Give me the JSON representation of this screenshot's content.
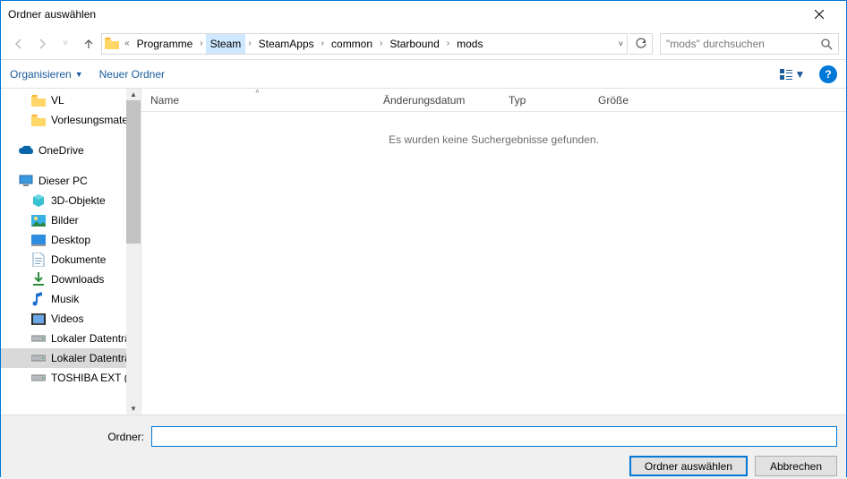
{
  "window": {
    "title": "Ordner auswählen"
  },
  "breadcrumb": {
    "overflow": "«",
    "segments": [
      {
        "label": "Programme",
        "selected": false
      },
      {
        "label": "Steam",
        "selected": true
      },
      {
        "label": "SteamApps",
        "selected": false
      },
      {
        "label": "common",
        "selected": false
      },
      {
        "label": "Starbound",
        "selected": false
      },
      {
        "label": "mods",
        "selected": false
      }
    ]
  },
  "search": {
    "placeholder": "\"mods\" durchsuchen"
  },
  "toolbar": {
    "organize": "Organisieren",
    "newfolder": "Neuer Ordner"
  },
  "columns": {
    "name": "Name",
    "date": "Änderungsdatum",
    "type": "Typ",
    "size": "Größe"
  },
  "list": {
    "empty": "Es wurden keine Suchergebnisse gefunden."
  },
  "tree": {
    "items": [
      {
        "label": "VL",
        "icon": "folder",
        "level": 2
      },
      {
        "label": "Vorlesungsmaterial",
        "icon": "folder",
        "level": 2
      },
      {
        "gap": true
      },
      {
        "label": "OneDrive",
        "icon": "onedrive",
        "level": 1
      },
      {
        "gap": true
      },
      {
        "label": "Dieser PC",
        "icon": "pc",
        "level": 1
      },
      {
        "label": "3D-Objekte",
        "icon": "3d",
        "level": 2
      },
      {
        "label": "Bilder",
        "icon": "pictures",
        "level": 2
      },
      {
        "label": "Desktop",
        "icon": "desktop",
        "level": 2
      },
      {
        "label": "Dokumente",
        "icon": "docs",
        "level": 2
      },
      {
        "label": "Downloads",
        "icon": "downloads",
        "level": 2
      },
      {
        "label": "Musik",
        "icon": "music",
        "level": 2
      },
      {
        "label": "Videos",
        "icon": "videos",
        "level": 2
      },
      {
        "label": "Lokaler Datenträger",
        "icon": "drive",
        "level": 2
      },
      {
        "label": "Lokaler Datenträger",
        "icon": "drive",
        "level": 2,
        "selected": true
      },
      {
        "label": "TOSHIBA EXT (F:)",
        "icon": "drive",
        "level": 2
      }
    ]
  },
  "bottom": {
    "label": "Ordner:",
    "value": "",
    "select": "Ordner auswählen",
    "cancel": "Abbrechen"
  }
}
